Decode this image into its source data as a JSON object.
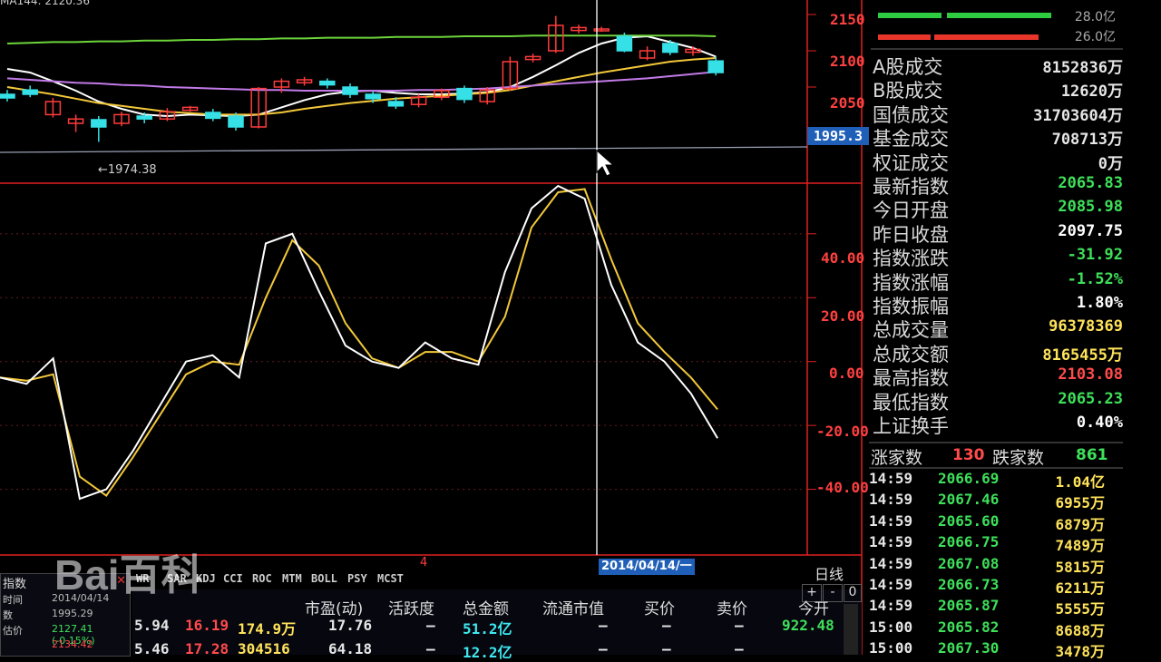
{
  "top_label": "MA144: 2120.36",
  "price_axis": {
    "ticks": [
      "2150",
      "2100",
      "2050"
    ],
    "current_marker": "1995.3"
  },
  "low_marker": "←1974.38",
  "volume_legend": [
    {
      "value": "28.0亿",
      "color": "#2ecc40"
    },
    {
      "value": "26.0亿",
      "color": "#e8362b"
    }
  ],
  "oscillator_axis": {
    "ticks": [
      "40.00",
      "20.00",
      "0.00",
      "-20.00",
      "-40.00"
    ]
  },
  "stats": [
    {
      "label": "A股成交",
      "value": "8152836万",
      "color": "#e6e6e6"
    },
    {
      "label": "B股成交",
      "value": "12620万",
      "color": "#e6e6e6"
    },
    {
      "label": "国债成交",
      "value": "31703604万",
      "color": "#e6e6e6"
    },
    {
      "label": "基金成交",
      "value": "708713万",
      "color": "#e6e6e6"
    },
    {
      "label": "权证成交",
      "value": "0万",
      "color": "#e6e6e6"
    },
    {
      "label": "最新指数",
      "value": "2065.83",
      "color": "#3ee05a"
    },
    {
      "label": "今日开盘",
      "value": "2085.98",
      "color": "#3ee05a"
    },
    {
      "label": "昨日收盘",
      "value": "2097.75",
      "color": "#ffffff"
    },
    {
      "label": "指数涨跌",
      "value": "-31.92",
      "color": "#3ee05a"
    },
    {
      "label": "指数涨幅",
      "value": "-1.52%",
      "color": "#3ee05a"
    },
    {
      "label": "指数振幅",
      "value": "1.80%",
      "color": "#ffffff"
    },
    {
      "label": "总成交量",
      "value": "96378369",
      "color": "#ffe35a"
    },
    {
      "label": "总成交额",
      "value": "8165455万",
      "color": "#ffe35a"
    },
    {
      "label": "最高指数",
      "value": "2103.08",
      "color": "#ff4b4b"
    },
    {
      "label": "最低指数",
      "value": "2065.23",
      "color": "#3ee05a"
    },
    {
      "label": "上证换手",
      "value": "0.40%",
      "color": "#ffffff"
    }
  ],
  "breadth": {
    "up_label": "涨家数",
    "up_value": "130",
    "down_label": "跌家数",
    "down_value": "861"
  },
  "trades": [
    {
      "time": "14:59",
      "price": "2066.69",
      "volume": "1.04亿"
    },
    {
      "time": "14:59",
      "price": "2067.46",
      "volume": "6955万"
    },
    {
      "time": "14:59",
      "price": "2065.60",
      "volume": "6879万"
    },
    {
      "time": "14:59",
      "price": "2066.75",
      "volume": "7489万"
    },
    {
      "time": "14:59",
      "price": "2067.08",
      "volume": "5815万"
    },
    {
      "time": "14:59",
      "price": "2066.73",
      "volume": "6211万"
    },
    {
      "time": "14:59",
      "price": "2065.87",
      "volume": "5555万"
    },
    {
      "time": "15:00",
      "price": "2065.82",
      "volume": "8688万"
    },
    {
      "time": "15:00",
      "price": "2067.30",
      "volume": "3478万"
    }
  ],
  "indicator_tabs": [
    "WR",
    "SAR",
    "KDJ",
    "CCI",
    "ROC",
    "MTM",
    "BOLL",
    "PSY",
    "MCST"
  ],
  "date_cursor": "2014/04/14/一",
  "period_label": "日线",
  "zoom_buttons": [
    "+",
    "-",
    "0"
  ],
  "page_marker": "4",
  "table": {
    "headers": [
      "市盈(动)",
      "活跃度",
      "总金额",
      "流通市值",
      "买价",
      "卖价",
      "今开"
    ],
    "rows": [
      {
        "a": "5.94",
        "b": "16.19",
        "c": "174.9万",
        "pe": "17.76",
        "act": "–",
        "amt": "51.2亿",
        "mv": "–",
        "bid": "–",
        "ask": "–",
        "open": "922.48"
      },
      {
        "a": "5.46",
        "b": "17.28",
        "c": "304516",
        "pe": "64.18",
        "act": "–",
        "amt": "12.2亿",
        "mv": "–",
        "bid": "–",
        "ask": "–",
        "open": ""
      }
    ]
  },
  "mini_panel": {
    "title": "指数",
    "rows": [
      {
        "label": "时间",
        "value": "2014/04/14"
      },
      {
        "label": "数",
        "value": "1995.29"
      },
      {
        "label": "估价",
        "value": "2127.41 (-0.15%)"
      },
      {
        "label": "",
        "value": "2134.42"
      }
    ]
  },
  "watermark": "Bai百科",
  "colors": {
    "up": "#ff3b3b",
    "down": "#35e0e6",
    "axis": "#e02020",
    "ma_white": "#ffffff",
    "ma_yellow": "#f2c83a",
    "ma_purple": "#c27ae8",
    "ma_green": "#6cd43a"
  },
  "chart_data": [
    {
      "type": "candlestick",
      "title": "",
      "ylim": [
        1960,
        2170
      ],
      "y_ticks": [
        2050,
        2100,
        2150
      ],
      "low_annotation": 1974.38,
      "candles": [
        {
          "o": 2040,
          "c": 2035,
          "h": 2046,
          "l": 2030
        },
        {
          "o": 2046,
          "c": 2040,
          "h": 2052,
          "l": 2036
        },
        {
          "o": 2012,
          "c": 2030,
          "h": 2035,
          "l": 2008
        },
        {
          "o": 2000,
          "c": 2006,
          "h": 2012,
          "l": 1988
        },
        {
          "o": 2005,
          "c": 1995,
          "h": 2010,
          "l": 1974.38
        },
        {
          "o": 2000,
          "c": 2012,
          "h": 2016,
          "l": 1996
        },
        {
          "o": 2010,
          "c": 2006,
          "h": 2015,
          "l": 2000
        },
        {
          "o": 2006,
          "c": 2016,
          "h": 2021,
          "l": 2003
        },
        {
          "o": 2018,
          "c": 2022,
          "h": 2024,
          "l": 2016
        },
        {
          "o": 2015,
          "c": 2007,
          "h": 2020,
          "l": 2003
        },
        {
          "o": 2010,
          "c": 1995,
          "h": 2015,
          "l": 1990
        },
        {
          "o": 1995,
          "c": 2048,
          "h": 2050,
          "l": 1993
        },
        {
          "o": 2050,
          "c": 2058,
          "h": 2062,
          "l": 2042
        },
        {
          "o": 2056,
          "c": 2060,
          "h": 2064,
          "l": 2052
        },
        {
          "o": 2058,
          "c": 2053,
          "h": 2062,
          "l": 2048
        },
        {
          "o": 2050,
          "c": 2040,
          "h": 2055,
          "l": 2035
        },
        {
          "o": 2040,
          "c": 2034,
          "h": 2044,
          "l": 2028
        },
        {
          "o": 2030,
          "c": 2024,
          "h": 2036,
          "l": 2020
        },
        {
          "o": 2026,
          "c": 2036,
          "h": 2040,
          "l": 2022
        },
        {
          "o": 2036,
          "c": 2045,
          "h": 2048,
          "l": 2032
        },
        {
          "o": 2048,
          "c": 2033,
          "h": 2052,
          "l": 2028
        },
        {
          "o": 2030,
          "c": 2046,
          "h": 2050,
          "l": 2026
        },
        {
          "o": 2048,
          "c": 2085,
          "h": 2092,
          "l": 2045
        },
        {
          "o": 2088,
          "c": 2092,
          "h": 2096,
          "l": 2084
        },
        {
          "o": 2100,
          "c": 2135,
          "h": 2148,
          "l": 2097
        },
        {
          "o": 2128,
          "c": 2132,
          "h": 2136,
          "l": 2124
        },
        {
          "o": 2130,
          "c": 2130,
          "h": 2133,
          "l": 2126
        },
        {
          "o": 2120,
          "c": 2100,
          "h": 2125,
          "l": 2098
        },
        {
          "o": 2090,
          "c": 2100,
          "h": 2106,
          "l": 2087
        },
        {
          "o": 2110,
          "c": 2098,
          "h": 2115,
          "l": 2094
        },
        {
          "o": 2098,
          "c": 2102,
          "h": 2106,
          "l": 2093
        },
        {
          "o": 2086,
          "c": 2070,
          "h": 2092,
          "l": 2066
        }
      ],
      "moving_averages": [
        {
          "color": "#ffffff",
          "values": [
            2075,
            2070,
            2058,
            2045,
            2030,
            2020,
            2012,
            2010,
            2012,
            2011,
            2010,
            2012,
            2022,
            2032,
            2040,
            2044,
            2045,
            2042,
            2040,
            2040,
            2041,
            2043,
            2050,
            2064,
            2080,
            2097,
            2110,
            2118,
            2120,
            2112,
            2104,
            2092
          ]
        },
        {
          "color": "#f2c83a",
          "values": [
            2050,
            2045,
            2040,
            2034,
            2028,
            2024,
            2020,
            2016,
            2014,
            2012,
            2012,
            2012,
            2015,
            2020,
            2024,
            2028,
            2031,
            2034,
            2036,
            2038,
            2040,
            2042,
            2046,
            2052,
            2058,
            2064,
            2070,
            2075,
            2080,
            2085,
            2088,
            2090
          ]
        },
        {
          "color": "#c27ae8",
          "values": [
            2062,
            2060,
            2058,
            2056,
            2055,
            2053,
            2052,
            2050,
            2049,
            2048,
            2047,
            2046,
            2046,
            2045,
            2045,
            2045,
            2045,
            2045,
            2046,
            2046,
            2047,
            2048,
            2050,
            2052,
            2054,
            2056,
            2058,
            2060,
            2062,
            2065,
            2068,
            2071
          ]
        },
        {
          "color": "#6cd43a",
          "values": [
            2110,
            2111,
            2112,
            2112,
            2113,
            2113,
            2114,
            2114,
            2115,
            2115,
            2116,
            2116,
            2117,
            2117,
            2118,
            2118,
            2118,
            2119,
            2119,
            2119,
            2120,
            2120,
            2120,
            2121,
            2121,
            2121,
            2121,
            2121,
            2121,
            2121,
            2121,
            2120
          ]
        }
      ]
    },
    {
      "type": "line",
      "title": "",
      "ylim": [
        -60,
        55
      ],
      "y_ticks": [
        40,
        20,
        0,
        -20,
        -40
      ],
      "series": [
        {
          "color": "#ffffff",
          "values": [
            -5,
            -7,
            1,
            -43,
            -40,
            -28,
            -14,
            0,
            2,
            -5,
            37,
            40,
            22,
            5,
            0,
            -2,
            6,
            1,
            -1,
            28,
            48,
            55,
            51,
            24,
            6,
            0,
            -10,
            -24
          ]
        },
        {
          "color": "#f2c83a",
          "values": [
            -5,
            -6,
            -4,
            -36,
            -42,
            -30,
            -17,
            -4,
            0,
            -1,
            20,
            38,
            30,
            12,
            1,
            -2,
            3,
            3,
            0,
            14,
            42,
            53,
            54,
            32,
            12,
            3,
            -5,
            -15
          ]
        }
      ]
    }
  ]
}
